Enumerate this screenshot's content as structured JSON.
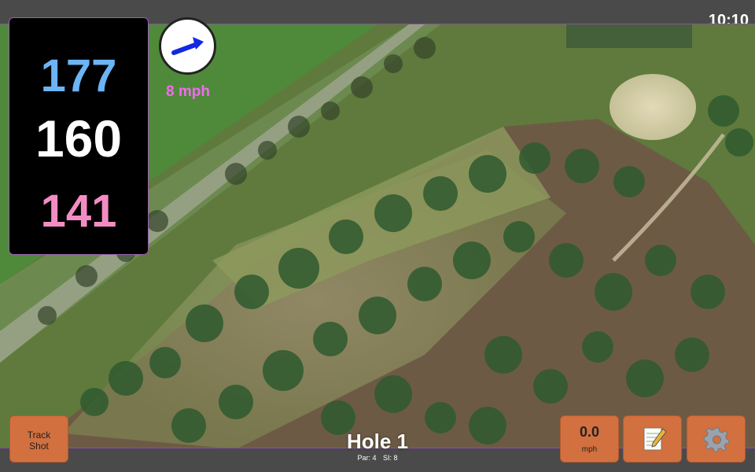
{
  "status": {
    "time": "10:10"
  },
  "yardages": {
    "back": "177",
    "middle": "160",
    "front": "141"
  },
  "wind": {
    "speed": "8 mph",
    "direction_icon": "wind-arrow-icon"
  },
  "hole": {
    "title": "Hole 1",
    "par": "Par: 4",
    "stroke_index": "SI: 8"
  },
  "buttons": {
    "track_shot": [
      "Track",
      "Shot"
    ],
    "speed_value": "0.0",
    "speed_unit": "mph",
    "notes_icon": "notepad-icon",
    "settings_icon": "gear-icon"
  },
  "colors": {
    "back_yardage": "#6cb4f4",
    "middle_yardage": "#ffffff",
    "front_yardage": "#f48cc4",
    "wind_text": "#f26bf0",
    "button": "#d2703f"
  }
}
